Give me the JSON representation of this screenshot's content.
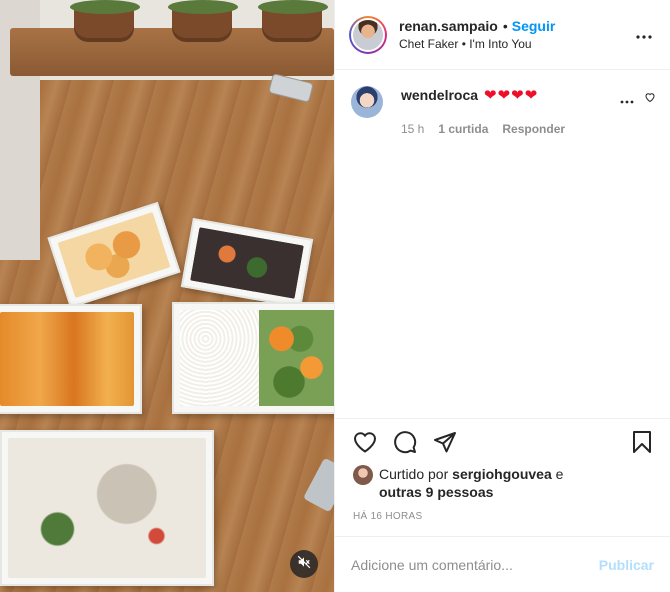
{
  "header": {
    "username": "renan.sampaio",
    "separator": "•",
    "follow_label": "Seguir",
    "audio": "Chet Faker • I'm Into You"
  },
  "comment": {
    "username": "wendelroca",
    "text": "❤❤❤❤",
    "time": "15 h",
    "likes": "1 curtida",
    "reply_label": "Responder"
  },
  "likes": {
    "prefix": "Curtido por",
    "user": "sergiohgouvea",
    "conj": "e",
    "others": "outras 9 pessoas"
  },
  "timestamp": "HÁ 16 HORAS",
  "add_comment": {
    "placeholder": "Adicione um comentário...",
    "publish_label": "Publicar"
  },
  "colors": {
    "accent": "#0095f6",
    "publish_disabled": "#b2dffc",
    "heart": "#ed0e2a",
    "muted": "#8e8e8e"
  },
  "icons": [
    "more-icon",
    "heart-icon",
    "comment-icon",
    "share-icon",
    "bookmark-icon",
    "mute-icon"
  ]
}
